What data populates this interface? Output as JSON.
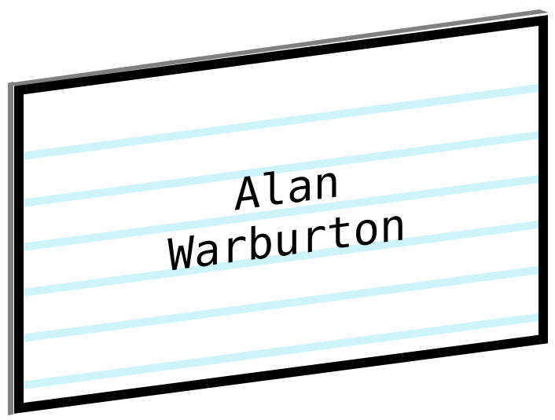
{
  "card": {
    "name_line1": "Alan",
    "name_line2": "Warburton"
  },
  "colors": {
    "frame": "#000000",
    "shadow_edge": "#808080",
    "card_fill": "#ffffff",
    "rule_lines": "#cdf3fb"
  }
}
